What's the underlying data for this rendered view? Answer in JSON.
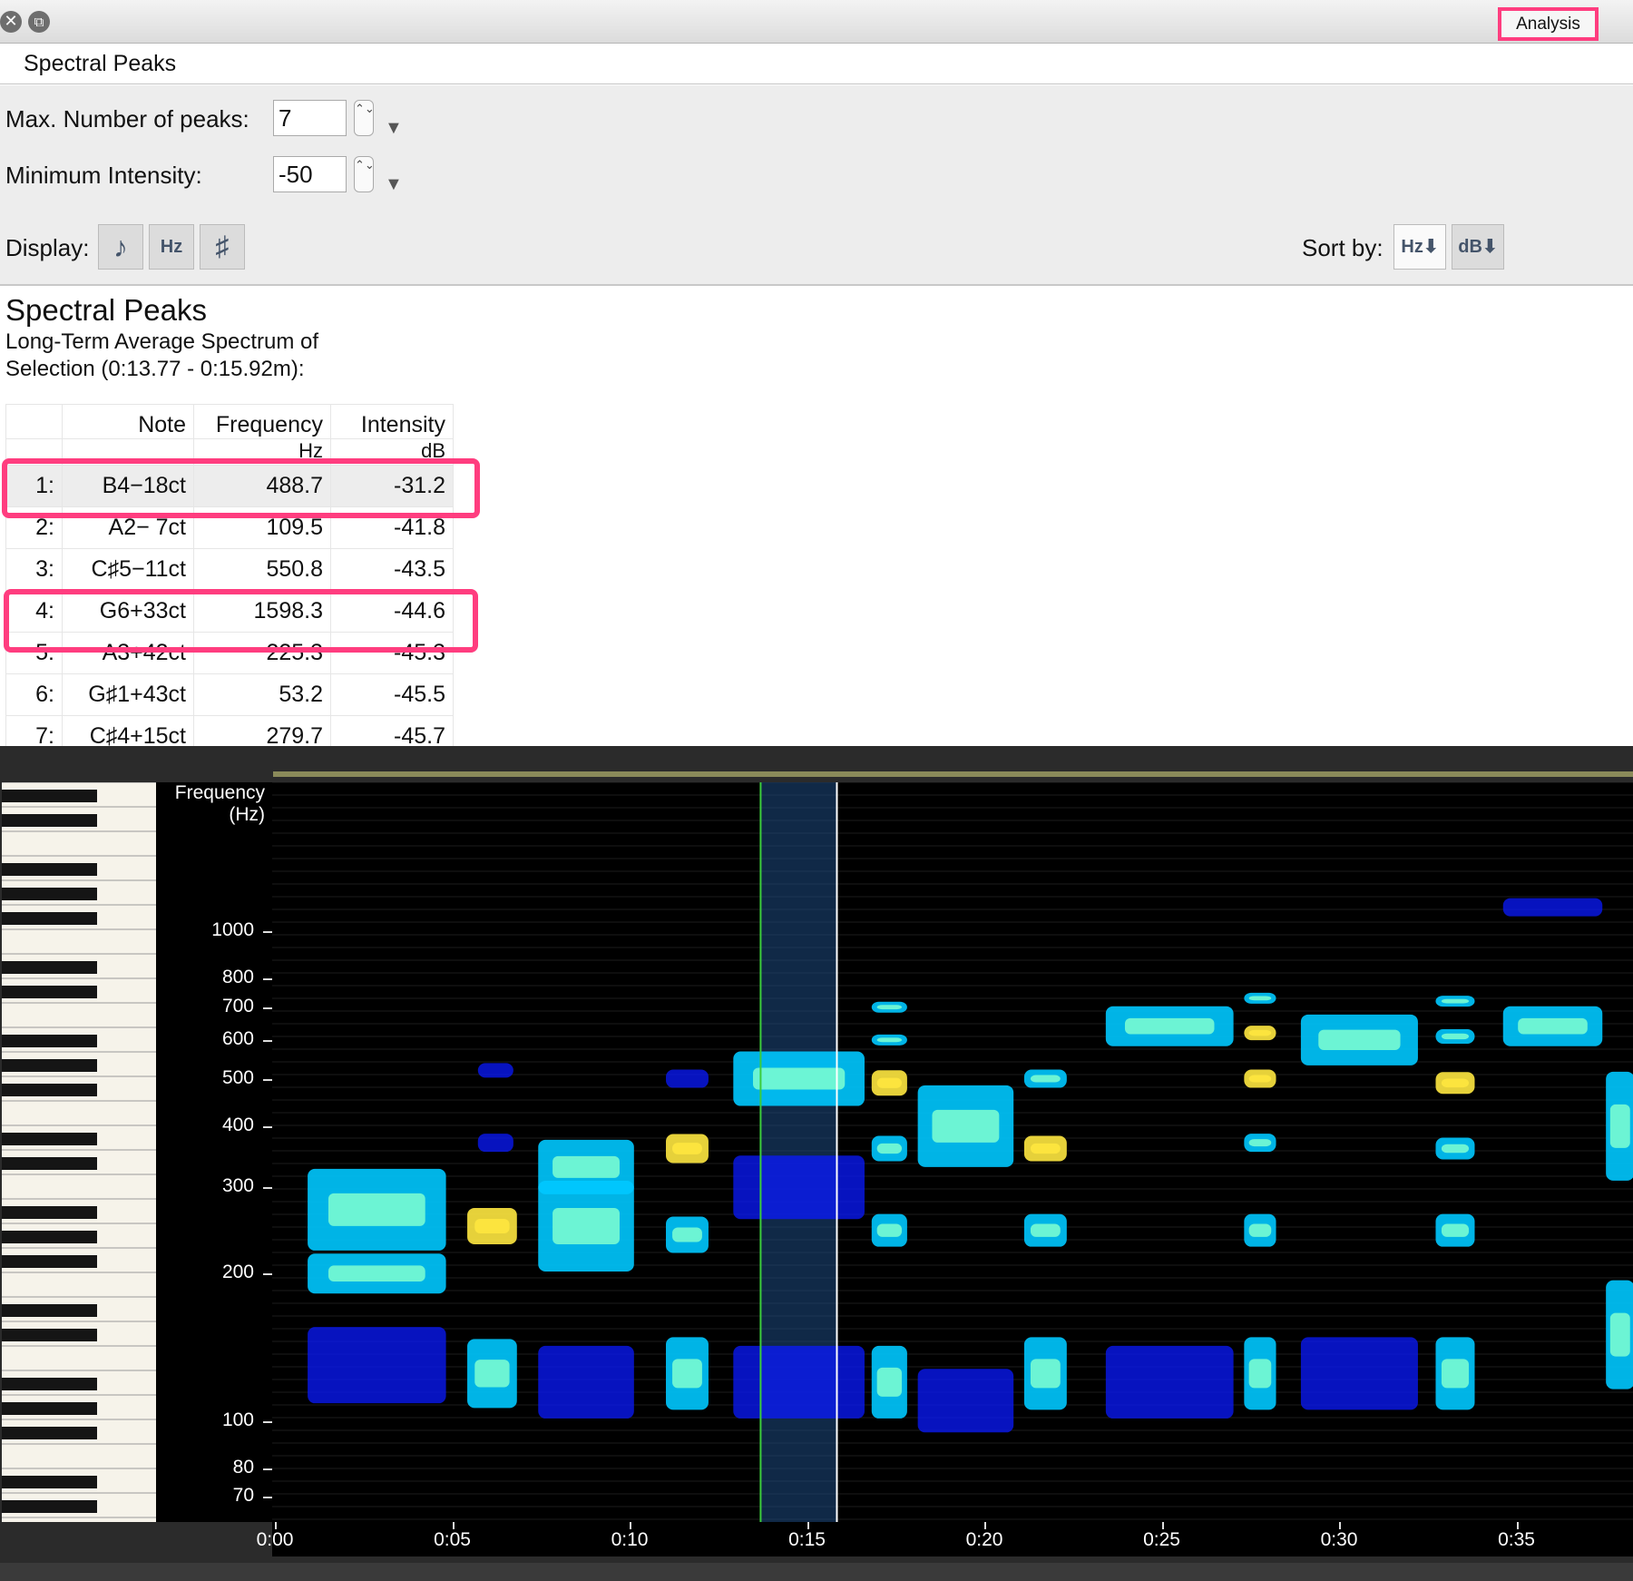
{
  "window": {
    "close_glyph": "✕",
    "restore_glyph": "⧉",
    "analysis_button": "Analysis"
  },
  "panel": {
    "title": "Spectral Peaks"
  },
  "controls": {
    "max_peaks_label": "Max. Number of peaks:",
    "max_peaks_value": "7",
    "min_intensity_label": "Minimum Intensity:",
    "min_intensity_value": "-50",
    "dropdown_glyph": "▼",
    "stepper_glyph": "⌃⌄",
    "display_label": "Display:",
    "display_buttons": [
      "♪",
      "Hz",
      "♯"
    ],
    "sort_label": "Sort by:",
    "sort_buttons": [
      "Hz⬇",
      "dB⬇"
    ]
  },
  "results": {
    "title": "Spectral Peaks",
    "subtitle_line1": "Long-Term Average Spectrum of",
    "subtitle_line2": "Selection (0:13.77 - 0:15.92m):",
    "headers": [
      "",
      "Note",
      "Frequency",
      "Intensity"
    ],
    "units": [
      "",
      "",
      "Hz",
      "dB"
    ],
    "rows": [
      {
        "idx": "1:",
        "note": "B4−18ct",
        "freq": "488.7",
        "db": "-31.2"
      },
      {
        "idx": "2:",
        "note": "A2− 7ct",
        "freq": "109.5",
        "db": "-41.8"
      },
      {
        "idx": "3:",
        "note": "C♯5−11ct",
        "freq": "550.8",
        "db": "-43.5"
      },
      {
        "idx": "4:",
        "note": "G6+33ct",
        "freq": "1598.3",
        "db": "-44.6"
      },
      {
        "idx": "5:",
        "note": "A3+42ct",
        "freq": "225.3",
        "db": "-45.3"
      },
      {
        "idx": "6:",
        "note": "G♯1+43ct",
        "freq": "53.2",
        "db": "-45.5"
      },
      {
        "idx": "7:",
        "note": "C♯4+15ct",
        "freq": "279.7",
        "db": "-45.7"
      }
    ]
  },
  "spectrogram": {
    "y_axis_title_line1": "Frequency",
    "y_axis_title_line2": "(Hz)",
    "y_ticks": [
      "1000",
      "800",
      "700",
      "600",
      "500",
      "400",
      "300",
      "200",
      "100",
      "80",
      "70"
    ],
    "x_ticks": [
      "0:00",
      "0:05",
      "0:10",
      "0:15",
      "0:20",
      "0:25",
      "0:30",
      "0:35"
    ],
    "selection": "0:13.77 - 0:15.92",
    "colors": {
      "background": "#000000",
      "low": "#0a1aff",
      "mid": "#00c8ff",
      "high": "#ffe840",
      "selection": "#1e4b82",
      "cursor": "#3ccc3c",
      "highlight": "#ff3d7f"
    }
  }
}
